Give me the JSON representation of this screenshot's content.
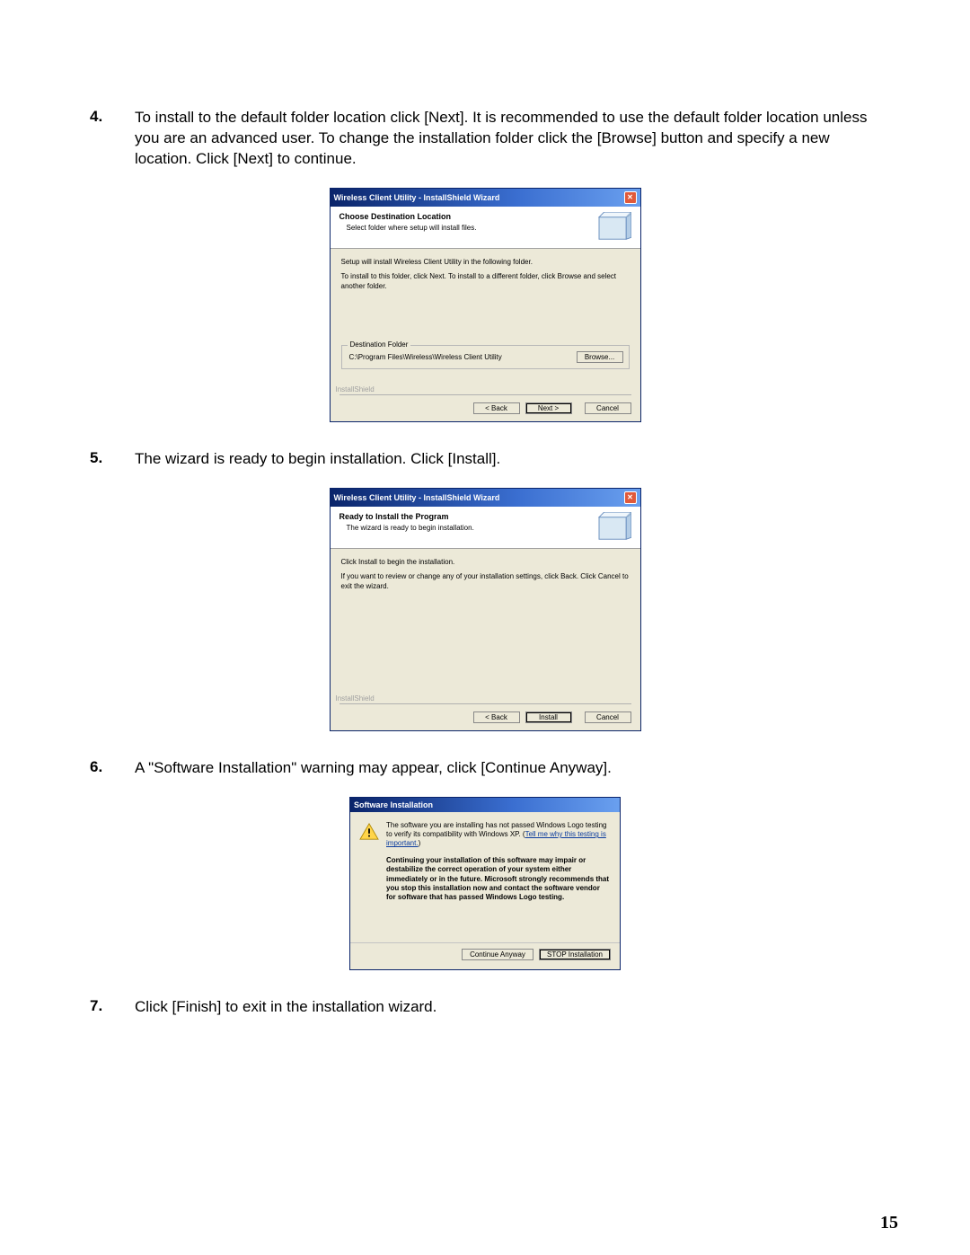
{
  "steps": {
    "4": {
      "num": "4.",
      "text": "To install to the default folder location click [Next]. It is recommended to use the default folder location unless you are an advanced user. To change the installation folder click the [Browse] button and specify a new location. Click [Next] to continue."
    },
    "5": {
      "num": "5.",
      "text": "The wizard is ready to begin installation. Click [Install]."
    },
    "6": {
      "num": "6.",
      "text": "A \"Software Installation\" warning may appear, click [Continue Anyway]."
    },
    "7": {
      "num": "7.",
      "text": "Click [Finish] to exit in the installation wizard."
    }
  },
  "window1": {
    "title": "Wireless Client Utility - InstallShield Wizard",
    "header_title": "Choose Destination Location",
    "header_sub": "Select folder where setup will install files.",
    "body_line1": "Setup will install Wireless Client Utility in the following folder.",
    "body_line2": "To install to this folder, click Next. To install to a different folder, click Browse and select another folder.",
    "dest_legend": "Destination Folder",
    "dest_path": "C:\\Program Files\\Wireless\\Wireless Client Utility",
    "browse": "Browse...",
    "brand": "InstallShield",
    "back": "< Back",
    "next": "Next >",
    "cancel": "Cancel"
  },
  "window2": {
    "title": "Wireless Client Utility - InstallShield Wizard",
    "header_title": "Ready to Install the Program",
    "header_sub": "The wizard is ready to begin installation.",
    "body_line1": "Click Install to begin the installation.",
    "body_line2": "If you want to review or change any of your installation settings, click Back. Click Cancel to exit the wizard.",
    "brand": "InstallShield",
    "back": "< Back",
    "install": "Install",
    "cancel": "Cancel"
  },
  "window3": {
    "title": "Software Installation",
    "para1a": "The software you are installing has not passed Windows Logo testing to verify its compatibility with Windows XP. (",
    "link": "Tell me why this testing is important.",
    "para1b": ")",
    "para2": "Continuing your installation of this software may impair or destabilize the correct operation of your system either immediately or in the future. Microsoft strongly recommends that you stop this installation now and contact the software vendor for software that has passed Windows Logo testing.",
    "continue": "Continue Anyway",
    "stop": "STOP Installation"
  },
  "page_number": "15"
}
